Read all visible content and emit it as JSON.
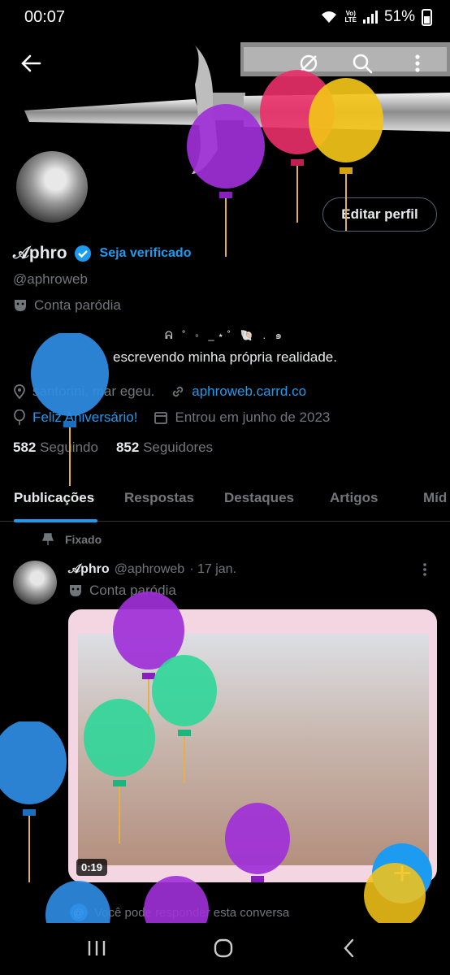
{
  "status_bar": {
    "time": "00:07",
    "network_line1": "Vo)",
    "network_line2": "LTE",
    "battery": "51%"
  },
  "profile": {
    "display_name": "𝒜phro",
    "verify_cta": "Seja verificado",
    "handle": "@aphroweb",
    "parody_label": "Conta paródia",
    "bio_decoration": "ᕱ ˚ ◦ _⋆˚ 🐚 . ๑",
    "bio": "escrevendo minha própria realidade.",
    "location": "santorini, mar egeu.",
    "website": "aphroweb.carrd.co",
    "birthday": "Feliz Aniversário!",
    "joined": "Entrou em junho de 2023",
    "following_count": "582",
    "following_label": "Seguindo",
    "followers_count": "852",
    "followers_label": "Seguidores",
    "edit_button": "Editar perfil"
  },
  "tabs": [
    {
      "label": "Publicações"
    },
    {
      "label": "Respostas"
    },
    {
      "label": "Destaques"
    },
    {
      "label": "Artigos"
    },
    {
      "label": "Míd"
    }
  ],
  "pinned_post": {
    "pinned_label": "Fixado",
    "author_name": "𝒜phro",
    "author_handle": "@aphroweb",
    "date": "· 17 jan.",
    "parody_label": "Conta paródia",
    "video_duration": "0:19",
    "reply_restriction": "Você pode responder esta conversa"
  },
  "fab": {
    "icon": "plus-icon"
  },
  "colors": {
    "accent": "#1d9bf0",
    "background": "#000000",
    "muted": "#71767b",
    "text": "#e7e9ea"
  }
}
